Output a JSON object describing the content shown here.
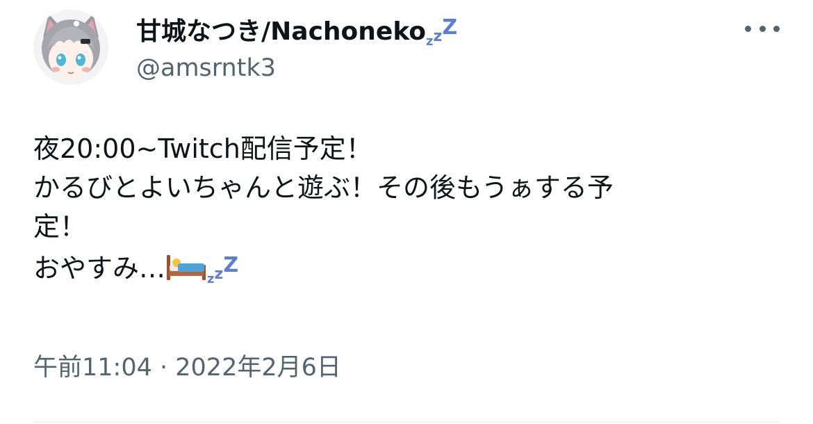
{
  "author": {
    "display_name": "甘城なつき/Nachoneko",
    "handle": "@amsrntk3"
  },
  "tweet": {
    "lines": [
      "夜20:00~Twitch配信予定！",
      "かるびとよいちゃんと遊ぶ！その後もうぁする予",
      "定！",
      "おやすみ…"
    ]
  },
  "meta": {
    "time": "午前11:04",
    "separator": " · ",
    "date": "2022年2月6日"
  },
  "icons": {
    "zzz": "zzz-sleep-icon",
    "bed": "bed-emoji-icon",
    "more": "more-options-icon"
  },
  "colors": {
    "zzz": "#5b7fd0",
    "secondary_text": "#536471"
  }
}
